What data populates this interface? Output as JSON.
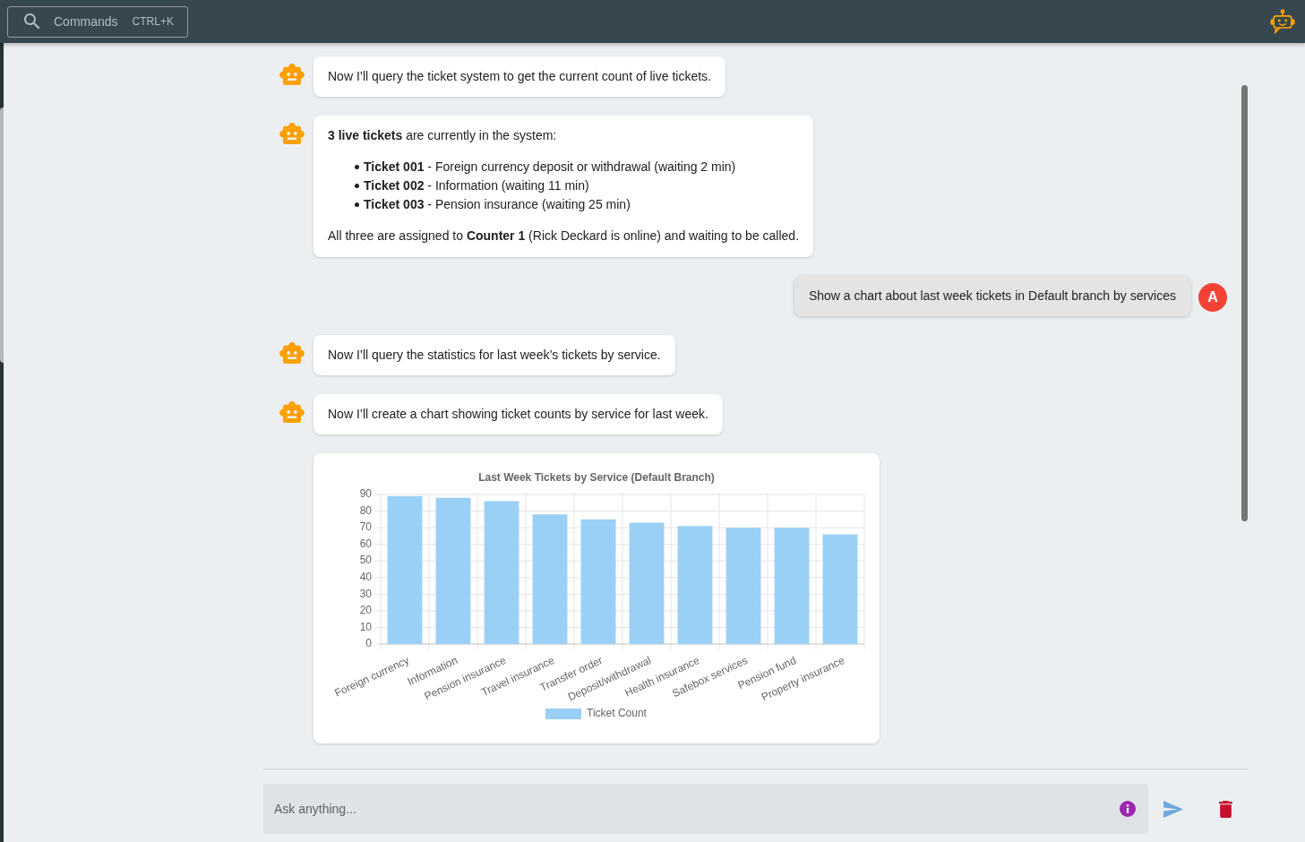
{
  "top_bar": {
    "commands_button": {
      "label": "Commands",
      "shortcut": "CTRL+K"
    }
  },
  "messages": [
    {
      "kind": "bot_text",
      "text": "Now I’ll query the ticket system to get the current count of live tickets."
    },
    {
      "kind": "bot_rich",
      "intro": "**3 live tickets** are currently in the system:",
      "items": [
        "**Ticket 001** - Foreign currency deposit or withdrawal (waiting 2 min)",
        "**Ticket 002** - Information (waiting 11 min)",
        "**Ticket 003** - Pension insurance (waiting 25 min)"
      ],
      "outro": "All three are assigned to **Counter 1** (Rick Deckard is online) and waiting to be called."
    },
    {
      "kind": "user_text",
      "text": "Show a chart about last week tickets in Default branch by services",
      "avatar_letter": "A"
    },
    {
      "kind": "bot_text",
      "text": "Now I’ll query the statistics for last week’s tickets by service."
    },
    {
      "kind": "bot_text",
      "text": "Now I’ll create a chart showing ticket counts by service for last week."
    },
    {
      "kind": "bot_chart",
      "chart_data": {
        "type": "bar",
        "title": "Last Week Tickets by Service (Default Branch)",
        "categories": [
          "Foreign currency",
          "Information",
          "Pension insurance",
          "Travel insurance",
          "Transfer order",
          "Deposit/withdrawal",
          "Health insurance",
          "Safebox services",
          "Pension fund",
          "Property insurance"
        ],
        "series": [
          {
            "name": "Ticket Count",
            "color": "#9ad0f5",
            "values": [
              89,
              88,
              86,
              78,
              75,
              73,
              71,
              70,
              70,
              66
            ]
          }
        ],
        "ylim": [
          0,
          90
        ],
        "yticks": [
          0,
          10,
          20,
          30,
          40,
          50,
          60,
          70,
          80,
          90
        ],
        "grid": true
      }
    }
  ],
  "composer": {
    "placeholder": "Ask anything..."
  }
}
